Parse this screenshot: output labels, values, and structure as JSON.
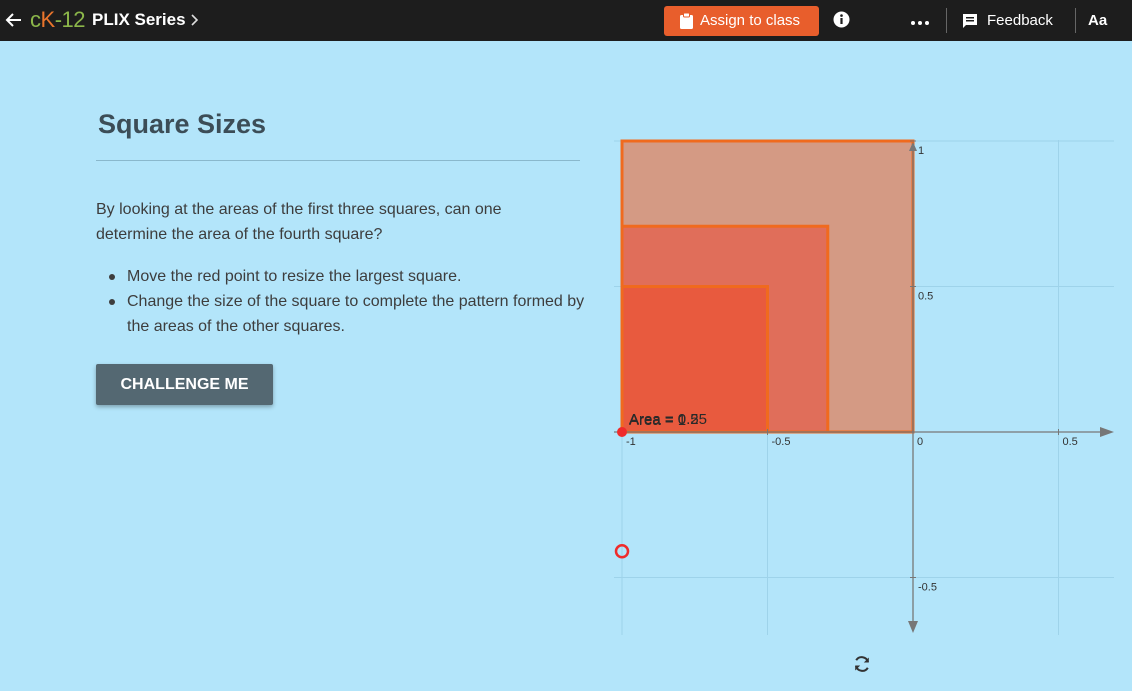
{
  "topbar": {
    "brand_prefix": "c",
    "brand_k": "K",
    "brand_suffix": "-12",
    "series": "PLIX Series",
    "assign_label": "Assign to class",
    "feedback_label": "Feedback",
    "font_size_label": "Aa",
    "icons": [
      "back-arrow-icon",
      "chevron-right-icon",
      "clipboard-icon",
      "info-icon",
      "more-dots-icon",
      "feedback-icon"
    ]
  },
  "main": {
    "title": "Square Sizes",
    "question": "By looking at the areas of the first three squares, can one determine the area of the fourth square?",
    "bullets": [
      "Move the red point to resize the largest square.",
      "Change the size of the square to complete the pattern formed by the areas of the other squares."
    ],
    "challenge_label": "CHALLENGE ME"
  },
  "graph": {
    "x_range": [
      -1.1,
      0.7
    ],
    "y_range": [
      -0.68,
      1.0
    ],
    "x_ticks": [
      -1,
      -0.5,
      0,
      0.5
    ],
    "x_tick_labels": [
      "-1",
      "-0.5",
      "0",
      "0.5"
    ],
    "y_ticks": [
      1,
      0.5,
      -0.5
    ],
    "y_tick_labels": [
      "1",
      "0.5",
      "-0.5"
    ],
    "squares": [
      {
        "side": 1,
        "label": "Area = 1",
        "fill": "#d49a84"
      },
      {
        "side": 0.7071,
        "label": "Area = 0.5",
        "fill": "#e06e5a"
      },
      {
        "side": 0.5,
        "label": "Area = 0.25",
        "fill": "#e85a3e"
      }
    ],
    "point": [
      -1,
      0
    ],
    "hollow_point": [
      -1,
      -0.41
    ],
    "colors": {
      "outline": "#f06a1e",
      "point": "#ef2b2b",
      "axis": "#777777",
      "grid": "#9ed3ea"
    }
  }
}
